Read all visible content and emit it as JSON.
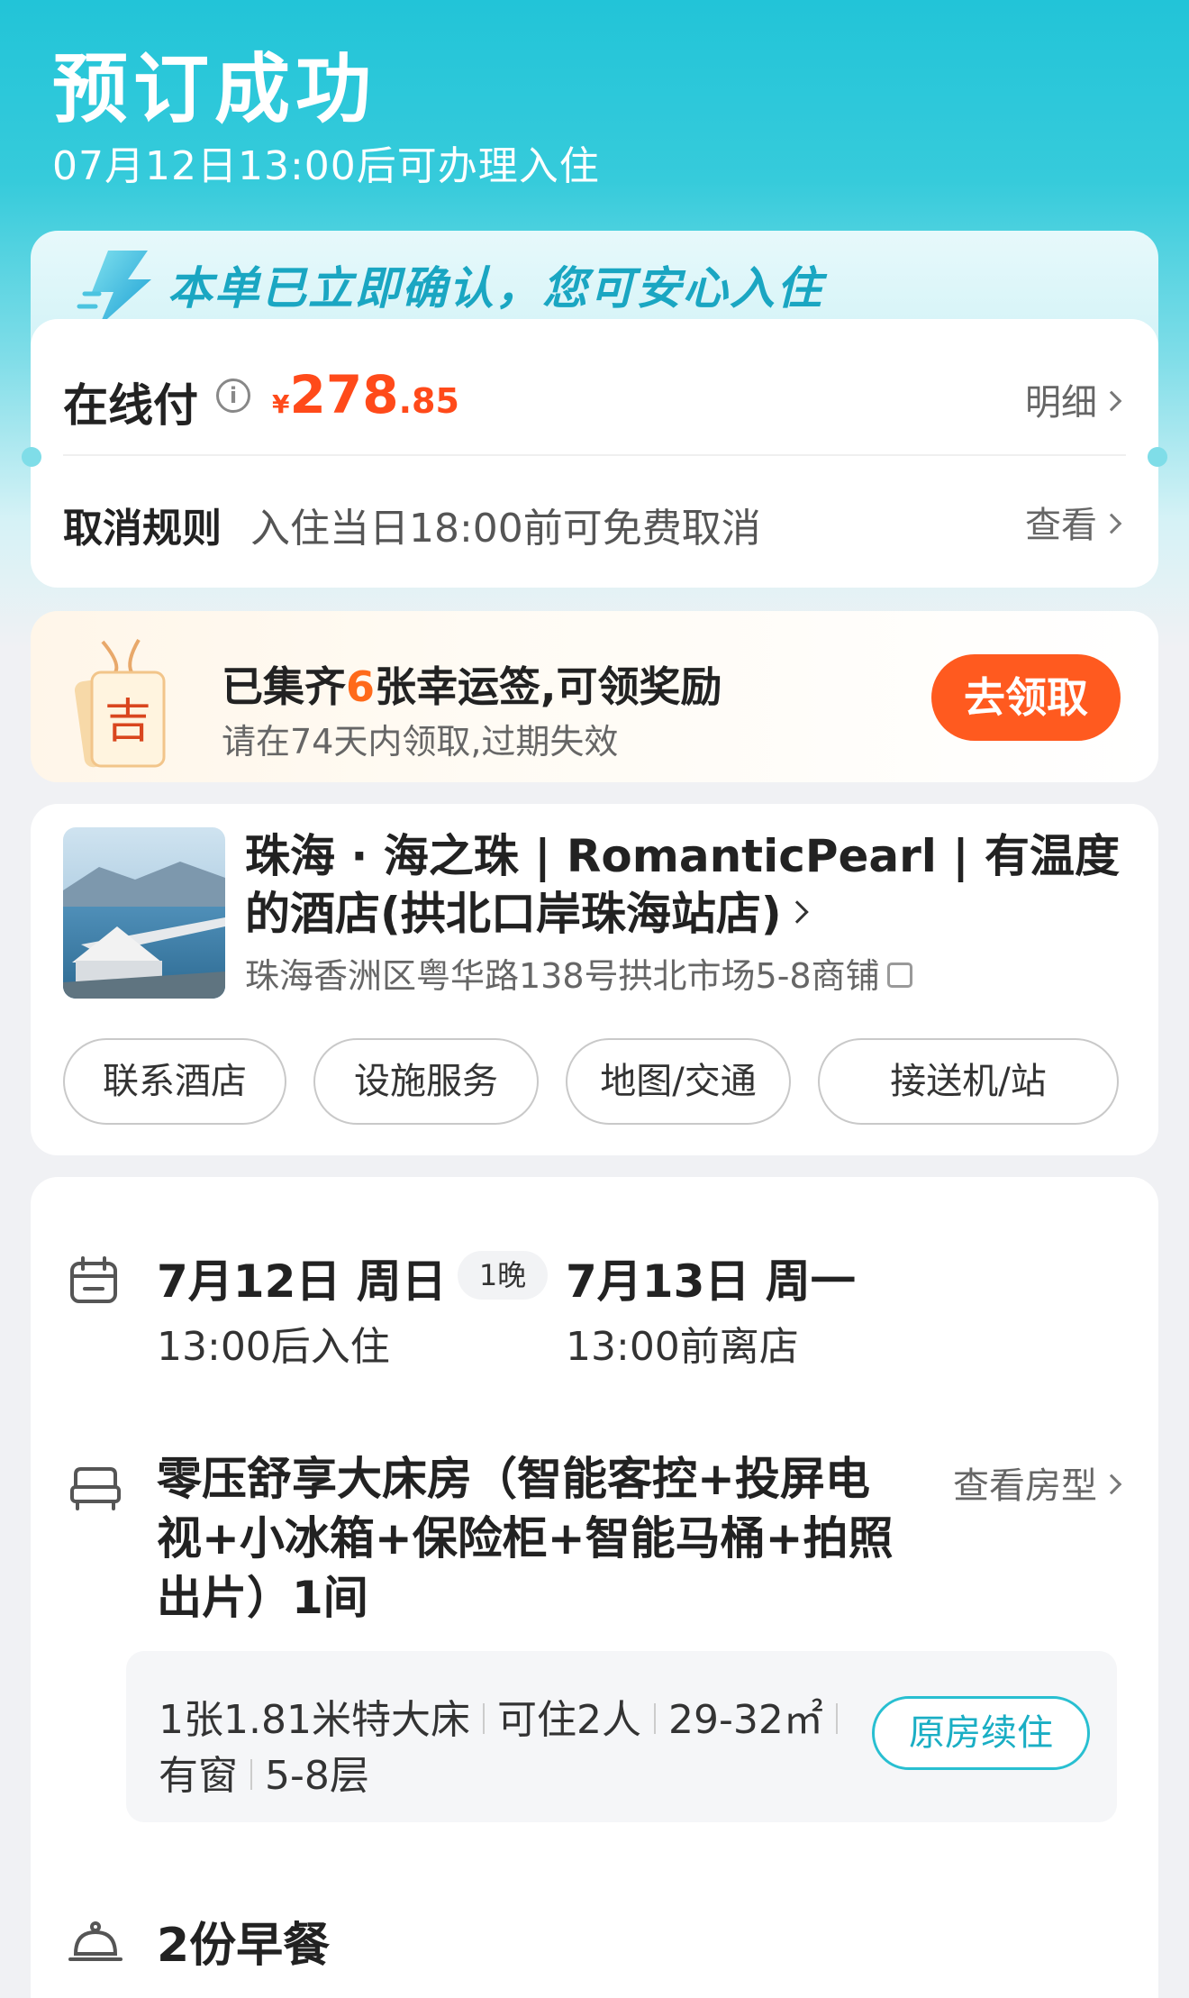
{
  "header": {
    "title": "预订成功",
    "subtitle": "07月12日13:00后可办理入住"
  },
  "confirm": {
    "banner_text": "本单已立即确认，您可安心入住",
    "pay_label": "在线付",
    "price_currency": "¥",
    "price_int": "278",
    "price_dec": ".85",
    "detail_link": "明细",
    "cancel_label": "取消规则",
    "cancel_text": "入住当日18:00前可免费取消",
    "cancel_link": "查看"
  },
  "lucky": {
    "tag_char": "吉",
    "title_prefix": "已集齐",
    "count": "6",
    "title_suffix": "张幸运签,可领奖励",
    "subtitle": "请在74天内领取,过期失效",
    "button": "去领取"
  },
  "hotel": {
    "name": "珠海 · 海之珠 | RomanticPearl | 有温度的酒店(拱北口岸珠海站店)",
    "address": "珠海香洲区粤华路138号拱北市场5-8商铺",
    "actions": [
      "联系酒店",
      "设施服务",
      "地图/交通",
      "接送机/站"
    ]
  },
  "stay": {
    "checkin_date": "7月12日 周日",
    "checkin_note": "13:00后入住",
    "nights": "1晚",
    "checkout_date": "7月13日 周一",
    "checkout_note": "13:00前离店"
  },
  "room": {
    "title": "零压舒享大床房（智能客控+投屏电视+小冰箱+保险柜+智能马桶+拍照出片）1间",
    "view_link": "查看房型",
    "bed": "1张1.81米特大床",
    "capacity": "可住2人",
    "area": "29-32㎡",
    "window": "有窗",
    "floor": "5-8层",
    "renew_button": "原房续住"
  },
  "breakfast": {
    "text": "2份早餐"
  },
  "colors": {
    "accent": "#22c4d8",
    "price": "#ff4a1a",
    "button": "#ff5a1f"
  }
}
